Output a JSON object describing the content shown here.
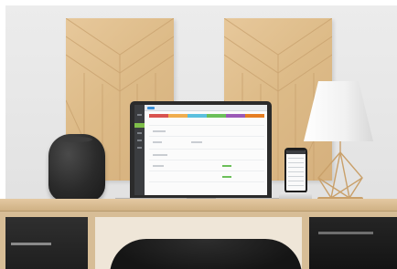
{
  "scene": {
    "colors": {
      "wall": "#e7e7e7",
      "wood_panel": "#ddbb88",
      "desk_top": "#d8bd96",
      "drawer": "#1f1f1f",
      "speaker": "#2a2a2a",
      "laptop_frame": "#2b2b2b",
      "lamp_shade": "#f4f4f4",
      "lamp_brass": "#c9a06a"
    },
    "objects": [
      "wood-panel-left",
      "wood-panel-right",
      "smart-speaker",
      "laptop",
      "smartphone-on-dock",
      "table-lamp",
      "desk",
      "office-chair"
    ]
  },
  "laptop_app": {
    "accent_colors": [
      "#d9534f",
      "#f0ad4e",
      "#5bc0de",
      "#6bbf59",
      "#9b59b6",
      "#e67e22"
    ],
    "status_color": "#6bbf59",
    "sidebar_color": "#3b3d40"
  }
}
